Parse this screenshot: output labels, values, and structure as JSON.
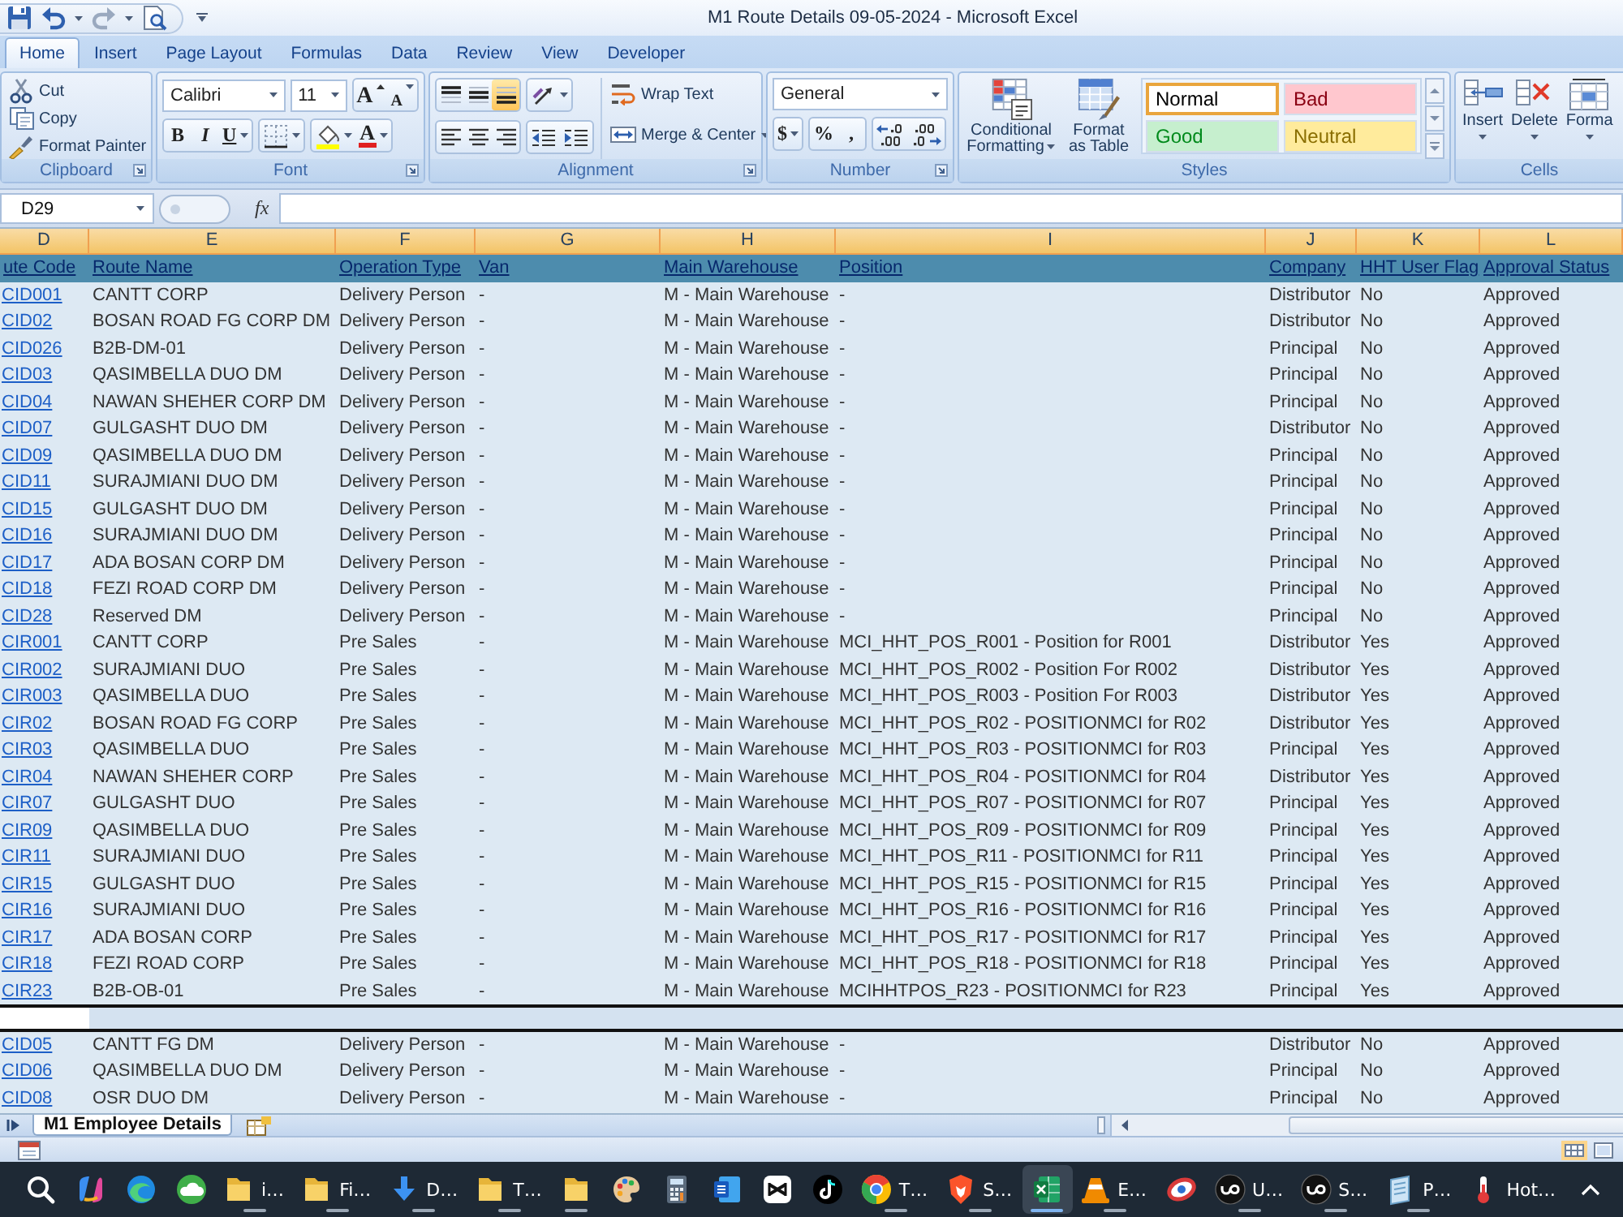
{
  "title_bar": {
    "title": "M1 Route Details 09-05-2024 - Microsoft Excel"
  },
  "tabs": [
    {
      "label": "Home",
      "selected": true
    },
    {
      "label": "Insert",
      "selected": false
    },
    {
      "label": "Page Layout",
      "selected": false
    },
    {
      "label": "Formulas",
      "selected": false
    },
    {
      "label": "Data",
      "selected": false
    },
    {
      "label": "Review",
      "selected": false
    },
    {
      "label": "View",
      "selected": false
    },
    {
      "label": "Developer",
      "selected": false
    }
  ],
  "ribbon": {
    "clipboard": {
      "label": "Clipboard",
      "buttons": [
        "Cut",
        "Copy",
        "Format Painter"
      ]
    },
    "font": {
      "label": "Font",
      "font_name": "Calibri",
      "font_size": "11",
      "grow": "A",
      "shrink": "A",
      "bold": "B",
      "italic": "I",
      "underline": "U",
      "font_color": "A"
    },
    "alignment": {
      "label": "Alignment",
      "vertical": [
        {
          "kind": "top",
          "selected": false
        },
        {
          "kind": "middle",
          "selected": false
        },
        {
          "kind": "bottom",
          "selected": true
        }
      ],
      "horizontal": [
        {
          "kind": "left",
          "selected": false
        },
        {
          "kind": "center",
          "selected": false
        },
        {
          "kind": "right",
          "selected": false
        }
      ],
      "wrap_text": "Wrap Text",
      "merge": "Merge & Center"
    },
    "number": {
      "label": "Number",
      "format": "General",
      "currency": "$",
      "percent": "%",
      "comma": ","
    },
    "styles": {
      "label": "Styles",
      "conditional": "Conditional Formatting",
      "format_table": "Format as Table",
      "gallery": [
        {
          "label": "Normal",
          "color": "#ffffff",
          "selected": true
        },
        {
          "label": "Bad",
          "color": "#ffc7ce",
          "selected": false
        },
        {
          "label": "Good",
          "color": "#c6efce",
          "selected": false
        },
        {
          "label": "Neutral",
          "color": "#ffeb9c",
          "selected": false
        }
      ]
    },
    "cells": {
      "label": "Cells",
      "buttons": [
        "Insert",
        "Delete",
        "Forma"
      ]
    }
  },
  "formula_bar": {
    "name_box": "D29",
    "function_label": "fx"
  },
  "sheet": {
    "columns": [
      {
        "letter": "D",
        "highlighted": true
      },
      {
        "letter": "E",
        "highlighted": true
      },
      {
        "letter": "F",
        "highlighted": true
      },
      {
        "letter": "G",
        "highlighted": true
      },
      {
        "letter": "H",
        "highlighted": true
      },
      {
        "letter": "I",
        "highlighted": true
      },
      {
        "letter": "J",
        "highlighted": true
      },
      {
        "letter": "K",
        "highlighted": true
      },
      {
        "letter": "L",
        "highlighted": true
      }
    ],
    "header": [
      "ute Code",
      "Route Name",
      "Operation Type",
      "Van",
      "Main Warehouse",
      "Position",
      "Company",
      "HHT User Flag",
      "Approval Status"
    ],
    "rows": [
      {
        "cells": [
          "CID001",
          "CANTT CORP",
          "Delivery Person",
          "-",
          "M - Main Warehouse",
          "-",
          "Distributor",
          "No",
          "Approved"
        ],
        "selected": false
      },
      {
        "cells": [
          "CID02",
          "BOSAN ROAD FG CORP DM",
          "Delivery Person",
          "-",
          "M - Main Warehouse",
          "-",
          "Distributor",
          "No",
          "Approved"
        ],
        "selected": false
      },
      {
        "cells": [
          "CID026",
          "B2B-DM-01",
          "Delivery Person",
          "-",
          "M - Main Warehouse",
          "-",
          "Principal",
          "No",
          "Approved"
        ],
        "selected": false
      },
      {
        "cells": [
          "CID03",
          "QASIMBELLA DUO DM",
          "Delivery Person",
          "-",
          "M - Main Warehouse",
          "-",
          "Principal",
          "No",
          "Approved"
        ],
        "selected": false
      },
      {
        "cells": [
          "CID04",
          "NAWAN SHEHER CORP DM",
          "Delivery Person",
          "-",
          "M - Main Warehouse",
          "-",
          "Principal",
          "No",
          "Approved"
        ],
        "selected": false
      },
      {
        "cells": [
          "CID07",
          "GULGASHT DUO DM",
          "Delivery Person",
          "-",
          "M - Main Warehouse",
          "-",
          "Distributor",
          "No",
          "Approved"
        ],
        "selected": false
      },
      {
        "cells": [
          "CID09",
          "QASIMBELLA DUO DM",
          "Delivery Person",
          "-",
          "M - Main Warehouse",
          "-",
          "Principal",
          "No",
          "Approved"
        ],
        "selected": false
      },
      {
        "cells": [
          "CID11",
          "SURAJMIANI DUO DM",
          "Delivery Person",
          "-",
          "M - Main Warehouse",
          "-",
          "Principal",
          "No",
          "Approved"
        ],
        "selected": false
      },
      {
        "cells": [
          "CID15",
          "GULGASHT DUO DM",
          "Delivery Person",
          "-",
          "M - Main Warehouse",
          "-",
          "Principal",
          "No",
          "Approved"
        ],
        "selected": false
      },
      {
        "cells": [
          "CID16",
          "SURAJMIANI DUO DM",
          "Delivery Person",
          "-",
          "M - Main Warehouse",
          "-",
          "Principal",
          "No",
          "Approved"
        ],
        "selected": false
      },
      {
        "cells": [
          "CID17",
          "ADA BOSAN CORP DM",
          "Delivery Person",
          "-",
          "M - Main Warehouse",
          "-",
          "Principal",
          "No",
          "Approved"
        ],
        "selected": false
      },
      {
        "cells": [
          "CID18",
          "FEZI ROAD CORP DM",
          "Delivery Person",
          "-",
          "M - Main Warehouse",
          "-",
          "Principal",
          "No",
          "Approved"
        ],
        "selected": false
      },
      {
        "cells": [
          "CID28",
          "Reserved DM",
          "Delivery Person",
          "-",
          "M - Main Warehouse",
          "-",
          "Principal",
          "No",
          "Approved"
        ],
        "selected": false
      },
      {
        "cells": [
          "CIR001",
          "CANTT CORP",
          "Pre Sales",
          "-",
          "M - Main Warehouse",
          "MCI_HHT_POS_R001 - Position for R001",
          "Distributor",
          "Yes",
          "Approved"
        ],
        "selected": false
      },
      {
        "cells": [
          "CIR002",
          "SURAJMIANI DUO",
          "Pre Sales",
          "-",
          "M - Main Warehouse",
          "MCI_HHT_POS_R002 - Position For R002",
          "Distributor",
          "Yes",
          "Approved"
        ],
        "selected": false
      },
      {
        "cells": [
          "CIR003",
          "QASIMBELLA DUO",
          "Pre Sales",
          "-",
          "M - Main Warehouse",
          "MCI_HHT_POS_R003 - Position For R003",
          "Distributor",
          "Yes",
          "Approved"
        ],
        "selected": false
      },
      {
        "cells": [
          "CIR02",
          "BOSAN ROAD FG CORP",
          "Pre Sales",
          "-",
          "M - Main Warehouse",
          "MCI_HHT_POS_R02 - POSITIONMCI for R02",
          "Distributor",
          "Yes",
          "Approved"
        ],
        "selected": false
      },
      {
        "cells": [
          "CIR03",
          "QASIMBELLA DUO",
          "Pre Sales",
          "-",
          "M - Main Warehouse",
          "MCI_HHT_POS_R03 - POSITIONMCI for R03",
          "Principal",
          "Yes",
          "Approved"
        ],
        "selected": false
      },
      {
        "cells": [
          "CIR04",
          "NAWAN SHEHER CORP",
          "Pre Sales",
          "-",
          "M - Main Warehouse",
          "MCI_HHT_POS_R04 - POSITIONMCI for R04",
          "Distributor",
          "Yes",
          "Approved"
        ],
        "selected": false
      },
      {
        "cells": [
          "CIR07",
          "GULGASHT DUO",
          "Pre Sales",
          "-",
          "M - Main Warehouse",
          "MCI_HHT_POS_R07 - POSITIONMCI for R07",
          "Principal",
          "Yes",
          "Approved"
        ],
        "selected": false
      },
      {
        "cells": [
          "CIR09",
          "QASIMBELLA DUO",
          "Pre Sales",
          "-",
          "M - Main Warehouse",
          "MCI_HHT_POS_R09 - POSITIONMCI for R09",
          "Principal",
          "Yes",
          "Approved"
        ],
        "selected": false
      },
      {
        "cells": [
          "CIR11",
          "SURAJMIANI DUO",
          "Pre Sales",
          "-",
          "M - Main Warehouse",
          "MCI_HHT_POS_R11 - POSITIONMCI for R11",
          "Principal",
          "Yes",
          "Approved"
        ],
        "selected": false
      },
      {
        "cells": [
          "CIR15",
          "GULGASHT DUO",
          "Pre Sales",
          "-",
          "M - Main Warehouse",
          "MCI_HHT_POS_R15 - POSITIONMCI for R15",
          "Principal",
          "Yes",
          "Approved"
        ],
        "selected": false
      },
      {
        "cells": [
          "CIR16",
          "SURAJMIANI DUO",
          "Pre Sales",
          "-",
          "M - Main Warehouse",
          "MCI_HHT_POS_R16 - POSITIONMCI for R16",
          "Principal",
          "Yes",
          "Approved"
        ],
        "selected": false
      },
      {
        "cells": [
          "CIR17",
          "ADA BOSAN CORP",
          "Pre Sales",
          "-",
          "M - Main Warehouse",
          "MCI_HHT_POS_R17 - POSITIONMCI for R17",
          "Principal",
          "Yes",
          "Approved"
        ],
        "selected": false
      },
      {
        "cells": [
          "CIR18",
          "FEZI ROAD CORP",
          "Pre Sales",
          "-",
          "M - Main Warehouse",
          "MCI_HHT_POS_R18 - POSITIONMCI for R18",
          "Principal",
          "Yes",
          "Approved"
        ],
        "selected": false
      },
      {
        "cells": [
          "CIR23",
          "B2B-OB-01",
          "Pre Sales",
          "-",
          "M - Main Warehouse",
          "MCIHHTPOS_R23 - POSITIONMCI for R23",
          "Principal",
          "Yes",
          "Approved"
        ],
        "selected": false
      },
      {
        "selected": true
      },
      {
        "cells": [
          "CID05",
          "CANTT FG DM",
          "Delivery Person",
          "-",
          "M - Main Warehouse",
          "-",
          "Distributor",
          "No",
          "Approved"
        ],
        "selected": false
      },
      {
        "cells": [
          "CID06",
          "QASIMBELLA DUO DM",
          "Delivery Person",
          "-",
          "M - Main Warehouse",
          "-",
          "Principal",
          "No",
          "Approved"
        ],
        "selected": false
      },
      {
        "cells": [
          "CID08",
          "OSR DUO DM",
          "Delivery Person",
          "-",
          "M - Main Warehouse",
          "-",
          "Principal",
          "No",
          "Approved"
        ],
        "selected": false
      }
    ]
  },
  "sheet_tabs": [
    {
      "label": "M1 Employee Details",
      "selected": true
    }
  ],
  "taskbar": {
    "items": [
      {
        "kind": "search",
        "selected": false,
        "running": false
      },
      {
        "kind": "swirl",
        "selected": false,
        "running": false
      },
      {
        "kind": "wave",
        "selected": false,
        "running": false
      },
      {
        "kind": "cloud",
        "selected": false,
        "running": false
      },
      {
        "kind": "folder",
        "label": "i…",
        "selected": false,
        "running": true
      },
      {
        "kind": "folder",
        "label": "Fi…",
        "selected": false,
        "running": true
      },
      {
        "kind": "download",
        "label": "D…",
        "selected": false,
        "running": true
      },
      {
        "kind": "folder",
        "label": "T…",
        "selected": false,
        "running": true
      },
      {
        "kind": "folder",
        "selected": false,
        "running": true
      },
      {
        "kind": "palette",
        "selected": false,
        "running": false
      },
      {
        "kind": "calculator",
        "selected": false,
        "running": false
      },
      {
        "kind": "document",
        "selected": false,
        "running": false
      },
      {
        "kind": "square",
        "selected": false,
        "running": false
      },
      {
        "kind": "note",
        "selected": false,
        "running": false
      },
      {
        "kind": "browser",
        "label": "T…",
        "selected": false,
        "running": true
      },
      {
        "kind": "shield",
        "label": "S…",
        "selected": false,
        "running": true
      },
      {
        "kind": "spreadsheet",
        "selected": true,
        "running": true
      },
      {
        "kind": "cone",
        "label": "E…",
        "selected": false,
        "running": true
      },
      {
        "kind": "ring",
        "selected": false,
        "running": false
      },
      {
        "kind": "badge",
        "label": "U…",
        "selected": false,
        "running": true
      },
      {
        "kind": "badge",
        "label": "S…",
        "selected": false,
        "running": true
      },
      {
        "kind": "notepad",
        "label": "P…",
        "selected": false,
        "running": true
      },
      {
        "kind": "thermometer",
        "label": "Hot…",
        "selected": false,
        "running": false
      },
      {
        "kind": "chevron",
        "selected": false,
        "running": false
      }
    ]
  }
}
